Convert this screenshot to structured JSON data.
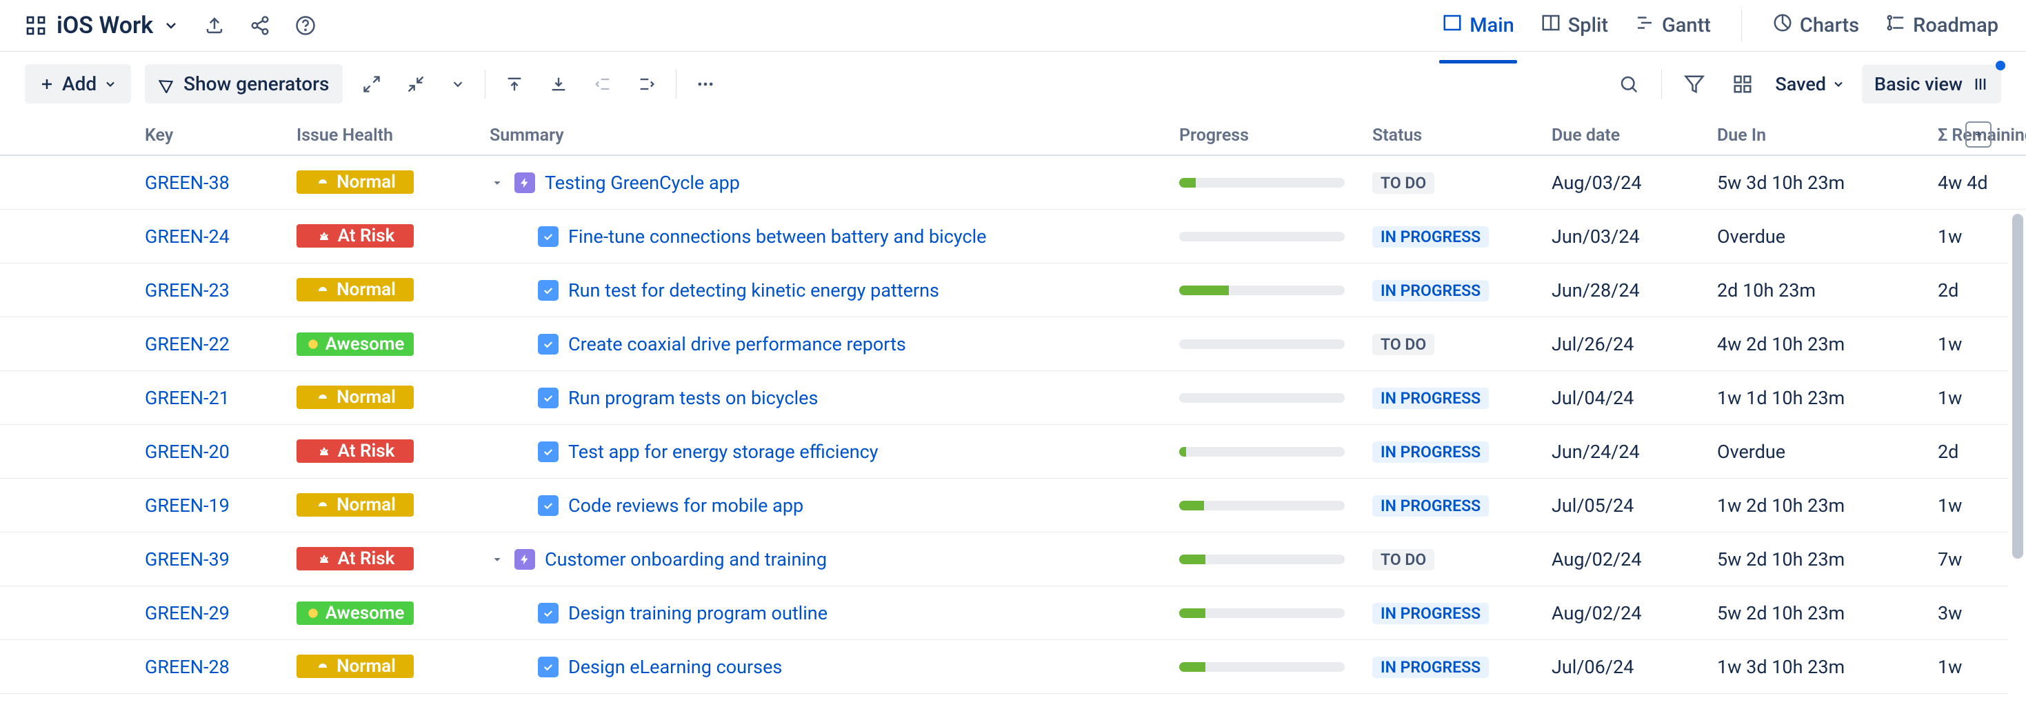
{
  "header": {
    "title": "iOS Work"
  },
  "tabs": [
    {
      "id": "main",
      "label": "Main",
      "active": true
    },
    {
      "id": "split",
      "label": "Split",
      "active": false
    },
    {
      "id": "gantt",
      "label": "Gantt",
      "active": false
    },
    {
      "id": "charts",
      "label": "Charts",
      "active": false,
      "group": 2
    },
    {
      "id": "roadmap",
      "label": "Roadmap",
      "active": false,
      "group": 2
    }
  ],
  "toolbar": {
    "add_label": "Add",
    "generators_label": "Show generators",
    "saved_label": "Saved",
    "basic_label": "Basic view"
  },
  "columns": {
    "key": "Key",
    "health": "Issue Health",
    "summary": "Summary",
    "progress": "Progress",
    "status": "Status",
    "due": "Due date",
    "duein": "Due In",
    "remaining": "Σ Remaining"
  },
  "statuses": {
    "todo": "TO DO",
    "inprogress": "IN PROGRESS"
  },
  "health_labels": {
    "normal": "Normal",
    "atrisk": "At Risk",
    "awesome": "Awesome"
  },
  "rows": [
    {
      "key": "GREEN-38",
      "health": "normal",
      "type": "epic",
      "indent": 0,
      "summary": "Testing GreenCycle app",
      "progress": 10,
      "status": "todo",
      "due": "Aug/03/24",
      "duein": "5w 3d 10h 23m",
      "remaining": "4w 4d"
    },
    {
      "key": "GREEN-24",
      "health": "atrisk",
      "type": "task",
      "indent": 1,
      "summary": "Fine-tune connections between battery and bicycle",
      "progress": 0,
      "status": "inprogress",
      "due": "Jun/03/24",
      "duein": "Overdue",
      "remaining": "1w"
    },
    {
      "key": "GREEN-23",
      "health": "normal",
      "type": "task",
      "indent": 1,
      "summary": "Run test for detecting kinetic energy patterns",
      "progress": 30,
      "status": "inprogress",
      "due": "Jun/28/24",
      "duein": "2d 10h 23m",
      "remaining": "2d"
    },
    {
      "key": "GREEN-22",
      "health": "awesome",
      "type": "task",
      "indent": 1,
      "summary": "Create coaxial drive performance reports",
      "progress": 0,
      "status": "todo",
      "due": "Jul/26/24",
      "duein": "4w 2d 10h 23m",
      "remaining": "1w"
    },
    {
      "key": "GREEN-21",
      "health": "normal",
      "type": "task",
      "indent": 1,
      "summary": "Run program tests on bicycles",
      "progress": 0,
      "status": "inprogress",
      "due": "Jul/04/24",
      "duein": "1w 1d 10h 23m",
      "remaining": "1w"
    },
    {
      "key": "GREEN-20",
      "health": "atrisk",
      "type": "task",
      "indent": 1,
      "summary": "Test app for energy storage efficiency",
      "progress": 4,
      "status": "inprogress",
      "due": "Jun/24/24",
      "duein": "Overdue",
      "remaining": "2d"
    },
    {
      "key": "GREEN-19",
      "health": "normal",
      "type": "task",
      "indent": 1,
      "summary": "Code reviews for mobile app",
      "progress": 15,
      "status": "inprogress",
      "due": "Jul/05/24",
      "duein": "1w 2d 10h 23m",
      "remaining": "1w"
    },
    {
      "key": "GREEN-39",
      "health": "atrisk",
      "type": "epic",
      "indent": 0,
      "summary": "Customer onboarding and training",
      "progress": 16,
      "status": "todo",
      "due": "Aug/02/24",
      "duein": "5w 2d 10h 23m",
      "remaining": "7w"
    },
    {
      "key": "GREEN-29",
      "health": "awesome",
      "type": "task",
      "indent": 1,
      "summary": "Design training program outline",
      "progress": 16,
      "status": "inprogress",
      "due": "Aug/02/24",
      "duein": "5w 2d 10h 23m",
      "remaining": "3w"
    },
    {
      "key": "GREEN-28",
      "health": "normal",
      "type": "task",
      "indent": 1,
      "summary": "Design eLearning courses",
      "progress": 16,
      "status": "inprogress",
      "due": "Jul/06/24",
      "duein": "1w 3d 10h 23m",
      "remaining": "1w"
    }
  ]
}
